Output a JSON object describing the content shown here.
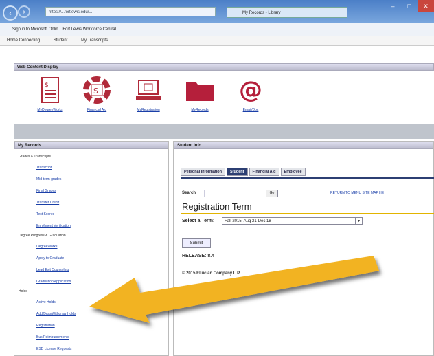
{
  "browser": {
    "address": "https://...fortlewis.edu/...",
    "tab_title": "My Records - Library",
    "favorites": "Sign in to Microsoft Onlin...   Fort Lewis Workforce Central...",
    "menu": [
      "Home Connecting",
      "Student",
      "My Transcripts"
    ]
  },
  "web_content": {
    "header": "Web Content Display",
    "tiles": [
      {
        "label": "MyDegreeWorks",
        "icon": "document-icon"
      },
      {
        "label": "Financial Aid",
        "icon": "life-ring-dollar-icon"
      },
      {
        "label": "MyRegistration",
        "icon": "computer-icon"
      },
      {
        "label": "MyRecords",
        "icon": "folder-icon"
      },
      {
        "label": "Email/Doc",
        "icon": "at-sign-icon"
      }
    ]
  },
  "my_records": {
    "header": "My Records",
    "sections": [
      {
        "title": "Grades & Transcripts",
        "links": [
          "Transcript",
          "Mid-term grades",
          "Final Grades",
          "Transfer Credit",
          "Test Scores",
          "Enrollment Verification"
        ]
      },
      {
        "title": "Degree Progress & Graduation",
        "links": [
          "DegreeWorks",
          "Apply to Graduate",
          "Lead Exit Counseling",
          "Graduation Application"
        ]
      },
      {
        "title": "Holds",
        "links": [
          "Active Holds",
          "Add/Drop/Withdraw Holds",
          "Registration",
          "Bus Reimbursements",
          "ESD License Requests"
        ]
      }
    ]
  },
  "student_info": {
    "header": "Student Info",
    "tabs": [
      "Personal Information",
      "Student",
      "Financial Aid",
      "Employee"
    ],
    "search_label": "Search",
    "go_label": "Go",
    "top_links": "RETURN TO MENU   SITE MAP   HE",
    "page_title": "Registration Term",
    "select_label": "Select a Term:",
    "selected_term": "Fall 2015, Aug 21-Dec 18",
    "submit_label": "Submit",
    "release": "RELEASE: 8.4",
    "copyright": "© 2015 Ellucian Company L.P."
  },
  "colors": {
    "arrow": "#f2b321",
    "tab_active": "#2c3f73",
    "titlebar": "#4b7fc7"
  }
}
